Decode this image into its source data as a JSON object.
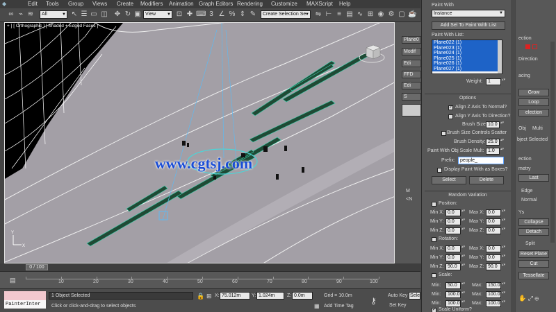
{
  "menu": [
    "Edit",
    "Tools",
    "Group",
    "Views",
    "Create",
    "Modifiers",
    "Animation",
    "Graph Editors",
    "Rendering",
    "Customize",
    "MAXScript",
    "Help"
  ],
  "toolbar": {
    "selection_filter": "All",
    "ref_coord": "View",
    "named_selection": "Create Selection Se"
  },
  "viewport": {
    "label": "+ ] [ Orthographic ] [ Shaded + Edged Faces ]",
    "watermark": "www.cgtsj.com",
    "background_color": "#a39fa6",
    "stripe_color": "#1f4a35",
    "road_color": "#000000"
  },
  "cmdstrip": {
    "items": [
      "Plane0",
      "Modif",
      "Edi",
      "FFD",
      "Edi",
      "S",
      "",
      "M",
      "<N"
    ]
  },
  "paint": {
    "paint_with_label": "Paint With",
    "paint_with_value": "Instance",
    "add_button": "Add Sel To Paint With List",
    "list_label": "Paint With List:",
    "list_items": [
      "Plane022 (1)",
      "Plane023 (1)",
      "Plane024 (1)",
      "Plane025 (1)",
      "Plane026 (1)",
      "Plane027 (1)"
    ],
    "weight_label": "Weight:",
    "weight_value": "1",
    "options_title": "Options",
    "align_z": "Align Z Axis To Normal?",
    "align_z_checked": true,
    "align_y": "Align Y Axis To Direction?",
    "align_y_checked": false,
    "brush_size_label": "Brush Size:",
    "brush_size_value": "10.0",
    "brush_scatter": "Brush Size Controls Scatter",
    "brush_scatter_checked": false,
    "brush_density_label": "Brush Density:",
    "brush_density_value": "25.0",
    "scale_mult_label": "Paint With Obj Scale Mult:",
    "scale_mult_value": "1.0",
    "prefix_label": "Prefix:",
    "prefix_value": "people_",
    "display_boxes": "Display Paint With as Boxes?",
    "display_boxes_checked": false,
    "select_button": "Select",
    "delete_button": "Delete",
    "random_title": "Random Variation",
    "position_label": "Position:",
    "rotation_label": "Rotation:",
    "scale_label": "Scale:",
    "position": [
      {
        "min_label": "Min X:",
        "min": "0.0",
        "max_label": "Max X:",
        "max": "0.0"
      },
      {
        "min_label": "Min Y:",
        "min": "0.0",
        "max_label": "Max Y:",
        "max": "0.0"
      },
      {
        "min_label": "Min Z:",
        "min": "0.0",
        "max_label": "Max Z:",
        "max": "0.0"
      }
    ],
    "rotation": [
      {
        "min_label": "Min X:",
        "min": "0.0",
        "max_label": "Max X:",
        "max": "0.0"
      },
      {
        "min_label": "Min Y:",
        "min": "0.0",
        "max_label": "Max Y:",
        "max": "0.0"
      },
      {
        "min_label": "Min Z:",
        "min": "90.0",
        "max_label": "Max Z:",
        "max": "90.0"
      }
    ],
    "scale": [
      {
        "min_label": "Min:",
        "min": "50.0",
        "max_label": "Max:",
        "max": "150.0"
      },
      {
        "min_label": "Min:",
        "min": "100.0",
        "max_label": "Max:",
        "max": "100.0"
      },
      {
        "min_label": "Min:",
        "min": "100.0",
        "max_label": "Max:",
        "max": "100.0"
      }
    ],
    "scale_uniform": "Scale Uniform?"
  },
  "modify": {
    "selection_label": "ection",
    "direction_label": "Direction",
    "spacing_label": "acing",
    "grow": "Grow",
    "loop": "Loop",
    "selection_btn": "election",
    "obj_radio": "Obj",
    "multi_radio": "Multi",
    "obj_selected": "bject Selected",
    "ection2": "ection",
    "geometry": "metry",
    "last": "Last",
    "edge": "Edge",
    "normal": "Normal",
    "ys": "Ys",
    "collapse": "Collapse",
    "detach": "Detach",
    "split": "Split",
    "reset_plane": "Reset Plane",
    "cut": "Cut",
    "tessellate": "Tessellate"
  },
  "timeline": {
    "slider": "0 / 100",
    "ticks": [
      "10",
      "20",
      "30",
      "40",
      "50",
      "60",
      "70",
      "80",
      "90",
      "100"
    ]
  },
  "status": {
    "maxscript": "PainterInter",
    "selected": "1 Object Selected",
    "hint": "Click or click-and-drag to select objects",
    "x_label": "X:",
    "x_value": "75.012m",
    "y_label": "Y:",
    "y_value": "1.024m",
    "z_label": "Z:",
    "z_value": "0.0m",
    "grid": "Grid = 10.0m",
    "add_time_tag": "Add Time Tag",
    "auto_key": "Auto Key",
    "set_key": "Set Key",
    "auto_key_sel": "Sele"
  }
}
